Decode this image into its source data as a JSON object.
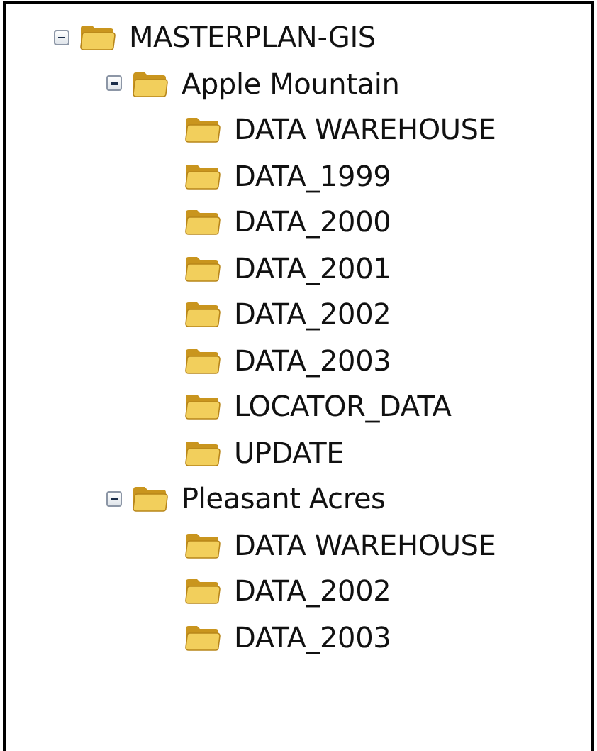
{
  "tree": [
    {
      "label": "MASTERPLAN-GIS",
      "expanded": true,
      "children": [
        {
          "label": "Apple Mountain",
          "expanded": true,
          "children": [
            {
              "label": "DATA WAREHOUSE"
            },
            {
              "label": "DATA_1999"
            },
            {
              "label": "DATA_2000"
            },
            {
              "label": "DATA_2001"
            },
            {
              "label": "DATA_2002"
            },
            {
              "label": "DATA_2003"
            },
            {
              "label": "LOCATOR_DATA"
            },
            {
              "label": "UPDATE"
            }
          ]
        },
        {
          "label": "Pleasant Acres",
          "expanded": true,
          "children": [
            {
              "label": "DATA WAREHOUSE"
            },
            {
              "label": "DATA_2002"
            },
            {
              "label": "DATA_2003"
            }
          ]
        }
      ]
    }
  ]
}
